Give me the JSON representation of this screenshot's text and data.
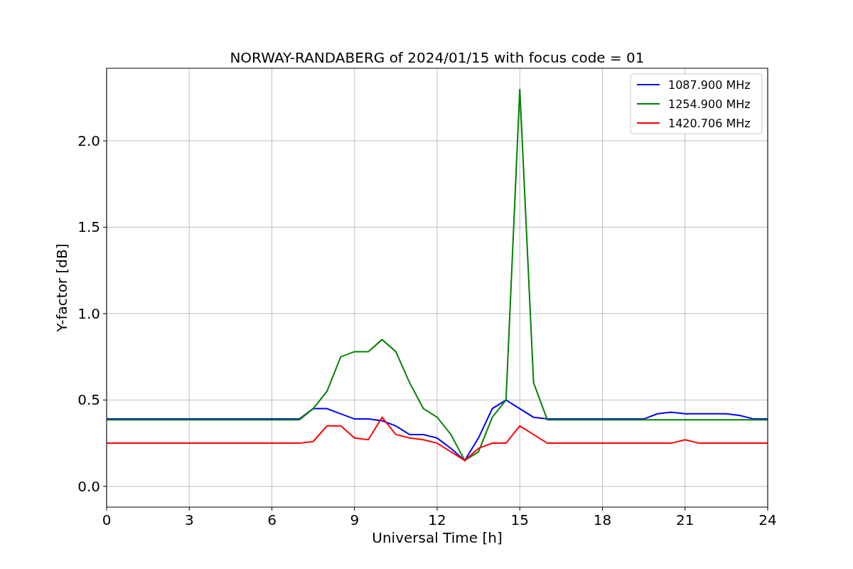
{
  "chart_data": {
    "type": "line",
    "title": "NORWAY-RANDABERG of 2024/01/15 with focus code = 01",
    "xlabel": "Universal Time [h]",
    "ylabel": "Y-factor [dB]",
    "x": [
      0,
      0.5,
      1,
      1.5,
      2,
      2.5,
      3,
      3.5,
      4,
      4.5,
      5,
      5.5,
      6,
      6.5,
      7,
      7.5,
      8,
      8.5,
      9,
      9.5,
      10,
      10.5,
      11,
      11.5,
      12,
      12.5,
      13,
      13.5,
      14,
      14.5,
      15,
      15.5,
      16,
      16.5,
      17,
      17.5,
      18,
      18.5,
      19,
      19.5,
      20,
      20.5,
      21,
      21.5,
      22,
      22.5,
      23,
      23.5,
      24
    ],
    "series": [
      {
        "name": "1087.900 MHz",
        "color": "#0000ff",
        "values": [
          0.39,
          0.39,
          0.39,
          0.39,
          0.39,
          0.39,
          0.39,
          0.39,
          0.39,
          0.39,
          0.39,
          0.39,
          0.39,
          0.39,
          0.39,
          0.45,
          0.45,
          0.42,
          0.39,
          0.39,
          0.38,
          0.35,
          0.3,
          0.3,
          0.28,
          0.22,
          0.15,
          0.28,
          0.45,
          0.5,
          0.45,
          0.4,
          0.39,
          0.39,
          0.39,
          0.39,
          0.39,
          0.39,
          0.39,
          0.39,
          0.42,
          0.43,
          0.42,
          0.42,
          0.42,
          0.42,
          0.41,
          0.39,
          0.39
        ]
      },
      {
        "name": "1254.900 MHz",
        "color": "#008000",
        "values": [
          0.385,
          0.385,
          0.385,
          0.385,
          0.385,
          0.385,
          0.385,
          0.385,
          0.385,
          0.385,
          0.385,
          0.385,
          0.385,
          0.385,
          0.385,
          0.45,
          0.55,
          0.75,
          0.78,
          0.78,
          0.85,
          0.78,
          0.6,
          0.45,
          0.4,
          0.3,
          0.15,
          0.2,
          0.4,
          0.5,
          2.3,
          0.6,
          0.385,
          0.385,
          0.385,
          0.385,
          0.385,
          0.385,
          0.385,
          0.385,
          0.385,
          0.385,
          0.385,
          0.385,
          0.385,
          0.385,
          0.385,
          0.385,
          0.385
        ]
      },
      {
        "name": "1420.706 MHz",
        "color": "#ff0000",
        "values": [
          0.25,
          0.25,
          0.25,
          0.25,
          0.25,
          0.25,
          0.25,
          0.25,
          0.25,
          0.25,
          0.25,
          0.25,
          0.25,
          0.25,
          0.25,
          0.26,
          0.35,
          0.35,
          0.28,
          0.27,
          0.4,
          0.3,
          0.28,
          0.27,
          0.25,
          0.2,
          0.15,
          0.22,
          0.25,
          0.25,
          0.35,
          0.3,
          0.25,
          0.25,
          0.25,
          0.25,
          0.25,
          0.25,
          0.25,
          0.25,
          0.25,
          0.25,
          0.27,
          0.25,
          0.25,
          0.25,
          0.25,
          0.25,
          0.25
        ]
      }
    ],
    "grid": true,
    "legend": true,
    "xlim": [
      0,
      24
    ],
    "ylim": [
      -0.12,
      2.42
    ],
    "xticks": [
      0,
      3,
      6,
      9,
      12,
      15,
      18,
      21,
      24
    ],
    "yticks": [
      {
        "value": 0,
        "label": "0.0"
      },
      {
        "value": 0.5,
        "label": "0.5"
      },
      {
        "value": 1,
        "label": "1.0"
      },
      {
        "value": 1.5,
        "label": "1.5"
      },
      {
        "value": 2,
        "label": "2.0"
      }
    ]
  }
}
